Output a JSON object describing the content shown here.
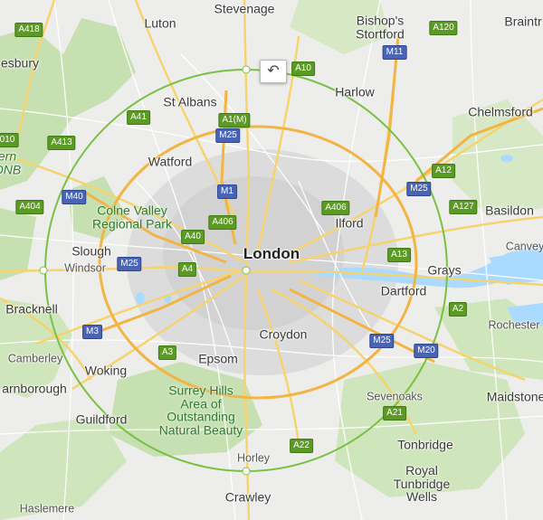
{
  "map": {
    "center_label": "London",
    "places": {
      "luton": "Luton",
      "stevenage": "Stevenage",
      "bishops_stortford": "Bishop's\nStortford",
      "braintree": "Braintr",
      "aylesbury": "esbury",
      "st_albans": "St Albans",
      "harlow": "Harlow",
      "chelmsford": "Chelmsford",
      "watford": "Watford",
      "chilterns": "ern\nONB",
      "ilford": "Ilford",
      "basildon": "Basildon",
      "canvey": "Canvey",
      "slough": "Slough",
      "windsor": "Windsor",
      "grays": "Grays",
      "dartford": "Dartford",
      "bracknell": "Bracknell",
      "rochester": "Rochester",
      "croydon": "Croydon",
      "camberley": "Camberley",
      "woking": "Woking",
      "epsom": "Epsom",
      "farnborough": "arnborough",
      "sevenoaks": "Sevenoaks",
      "maidstone": "Maidstone",
      "guildford": "Guildford",
      "tonbridge": "Tonbridge",
      "horley": "Horley",
      "royal_tunbridge_wells": "Royal\nTunbridge\nWells",
      "crawley": "Crawley",
      "haslemere": "Haslemere"
    },
    "parks": {
      "colne_valley": "Colne Valley\nRegional Park",
      "surrey_hills": "Surrey Hills\nArea of\nOutstanding\nNatural Beauty"
    },
    "roads": {
      "a418": "A418",
      "a120": "A120",
      "a10": "A10",
      "m11": "M11",
      "a41": "A41",
      "a1m": "A1(M)",
      "m25_n": "M25",
      "a413": "A413",
      "a4010": "010",
      "a12": "A12",
      "m40": "M40",
      "m1": "M1",
      "a406_w": "A406",
      "a406_e": "A406",
      "m25_ne": "M25",
      "a404": "A404",
      "a127": "A127",
      "a40": "A40",
      "a13": "A13",
      "m25_w": "M25",
      "a4": "A4",
      "a2": "A2",
      "m3": "M3",
      "m25_se": "M25",
      "a3": "A3",
      "m20": "M20",
      "a21": "A21",
      "a22": "A22"
    },
    "undo_icon": "undo-icon",
    "radius_circle_color": "#7ac143"
  }
}
